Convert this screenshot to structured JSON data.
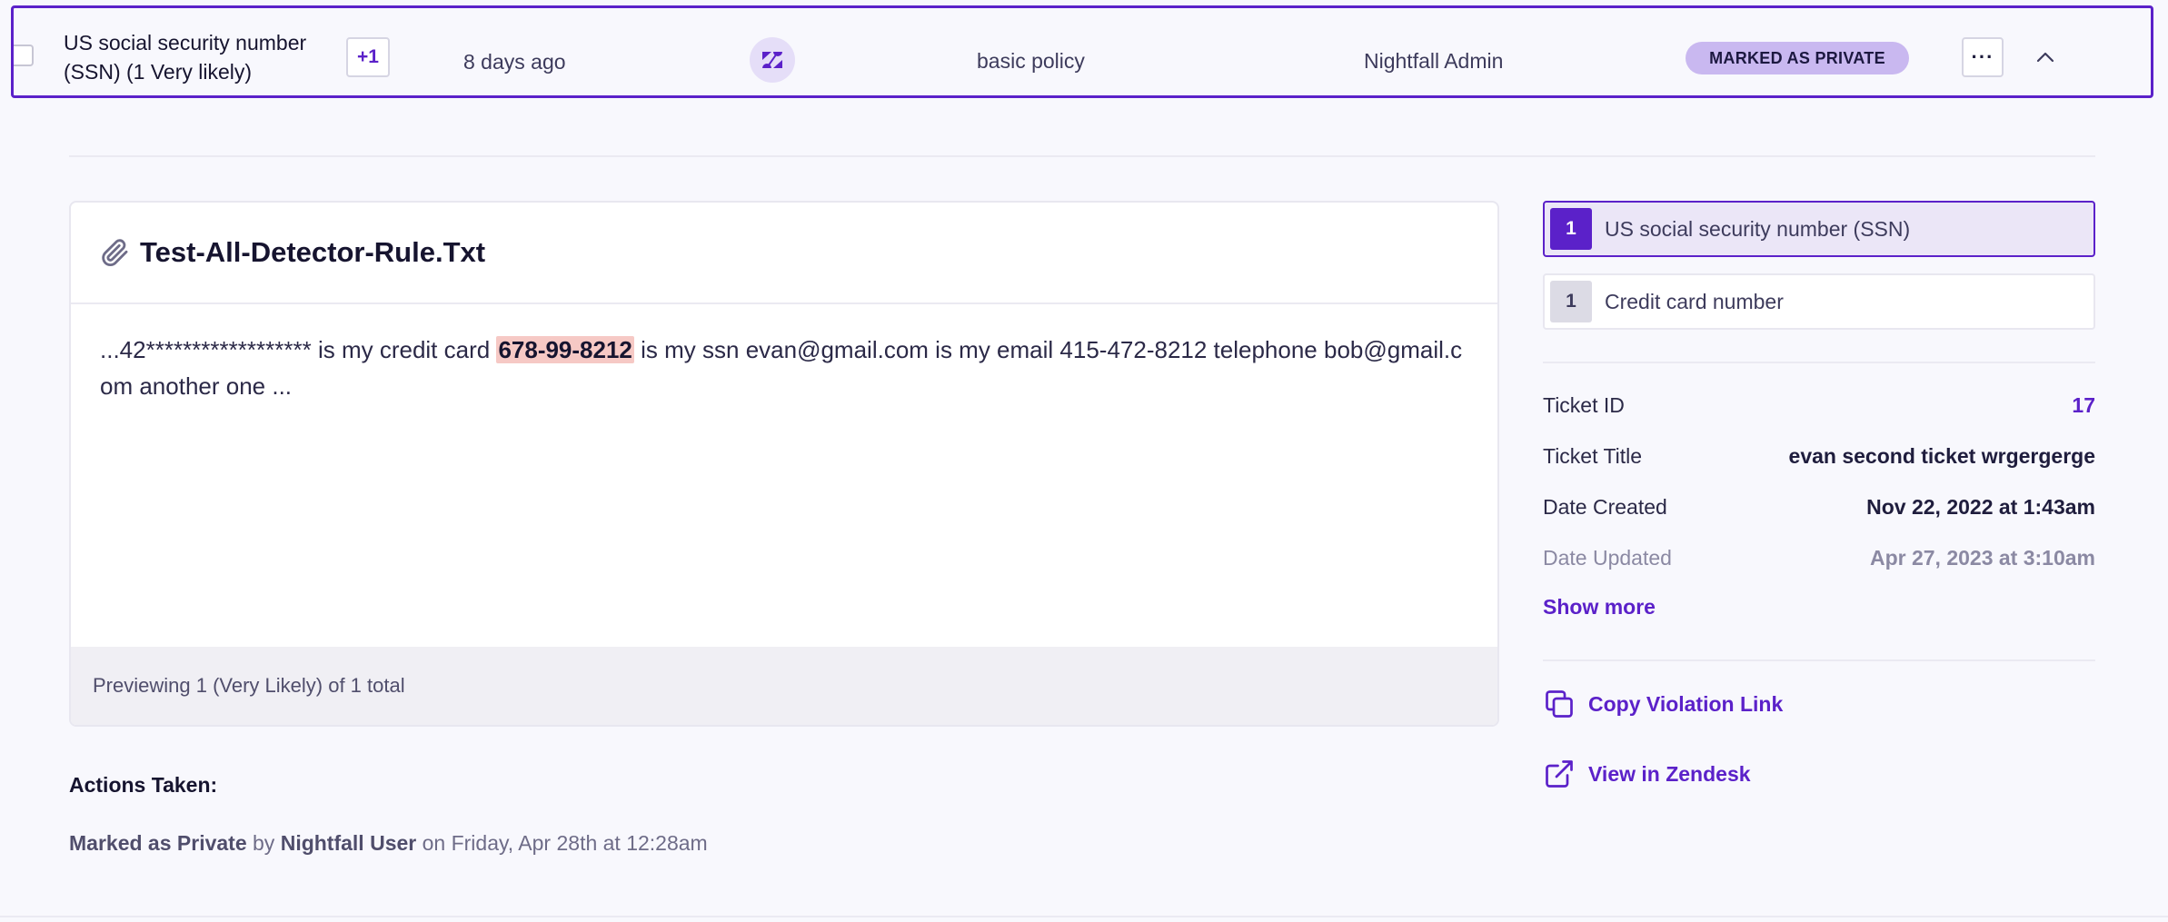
{
  "row": {
    "detector": "US social security number (SSN) (1 Very likely)",
    "extra_count": "+1",
    "time": "8 days ago",
    "integration_icon": "zendesk-icon",
    "policy": "basic policy",
    "actor": "Nightfall Admin",
    "status": "MARKED AS PRIVATE",
    "more_label": "···"
  },
  "preview": {
    "file_name": "Test-All-Detector-Rule.Txt",
    "text_before": "...42****************** is my credit card ",
    "highlight": "678-99-8212",
    "text_after": " is my ssn evan@gmail.com is my email 415-472-8212 telephone bob@gmail.com another one ...",
    "footer": "Previewing 1 (Very Likely) of 1 total"
  },
  "actions": {
    "label": "Actions Taken:",
    "action": "Marked as Private",
    "by": "by",
    "user": "Nightfall User",
    "when": "on Friday, Apr 28th at 12:28am"
  },
  "detectors": [
    {
      "count": "1",
      "label": "US social security number (SSN)"
    },
    {
      "count": "1",
      "label": "Credit card number"
    }
  ],
  "meta": {
    "ticket_id_key": "Ticket ID",
    "ticket_id_val": "17",
    "ticket_title_key": "Ticket Title",
    "ticket_title_val": "evan second ticket wrgergerge",
    "created_key": "Date Created",
    "created_val": "Nov 22, 2022 at 1:43am",
    "updated_key": "Date Updated",
    "updated_val": "Apr 27, 2023 at 3:10am",
    "show_more": "Show more"
  },
  "links": {
    "copy": "Copy Violation Link",
    "view": "View in Zendesk"
  },
  "colors": {
    "accent": "#5b21c9",
    "highlight": "#f6c9c5",
    "status_pill": "#c9b8f0"
  }
}
